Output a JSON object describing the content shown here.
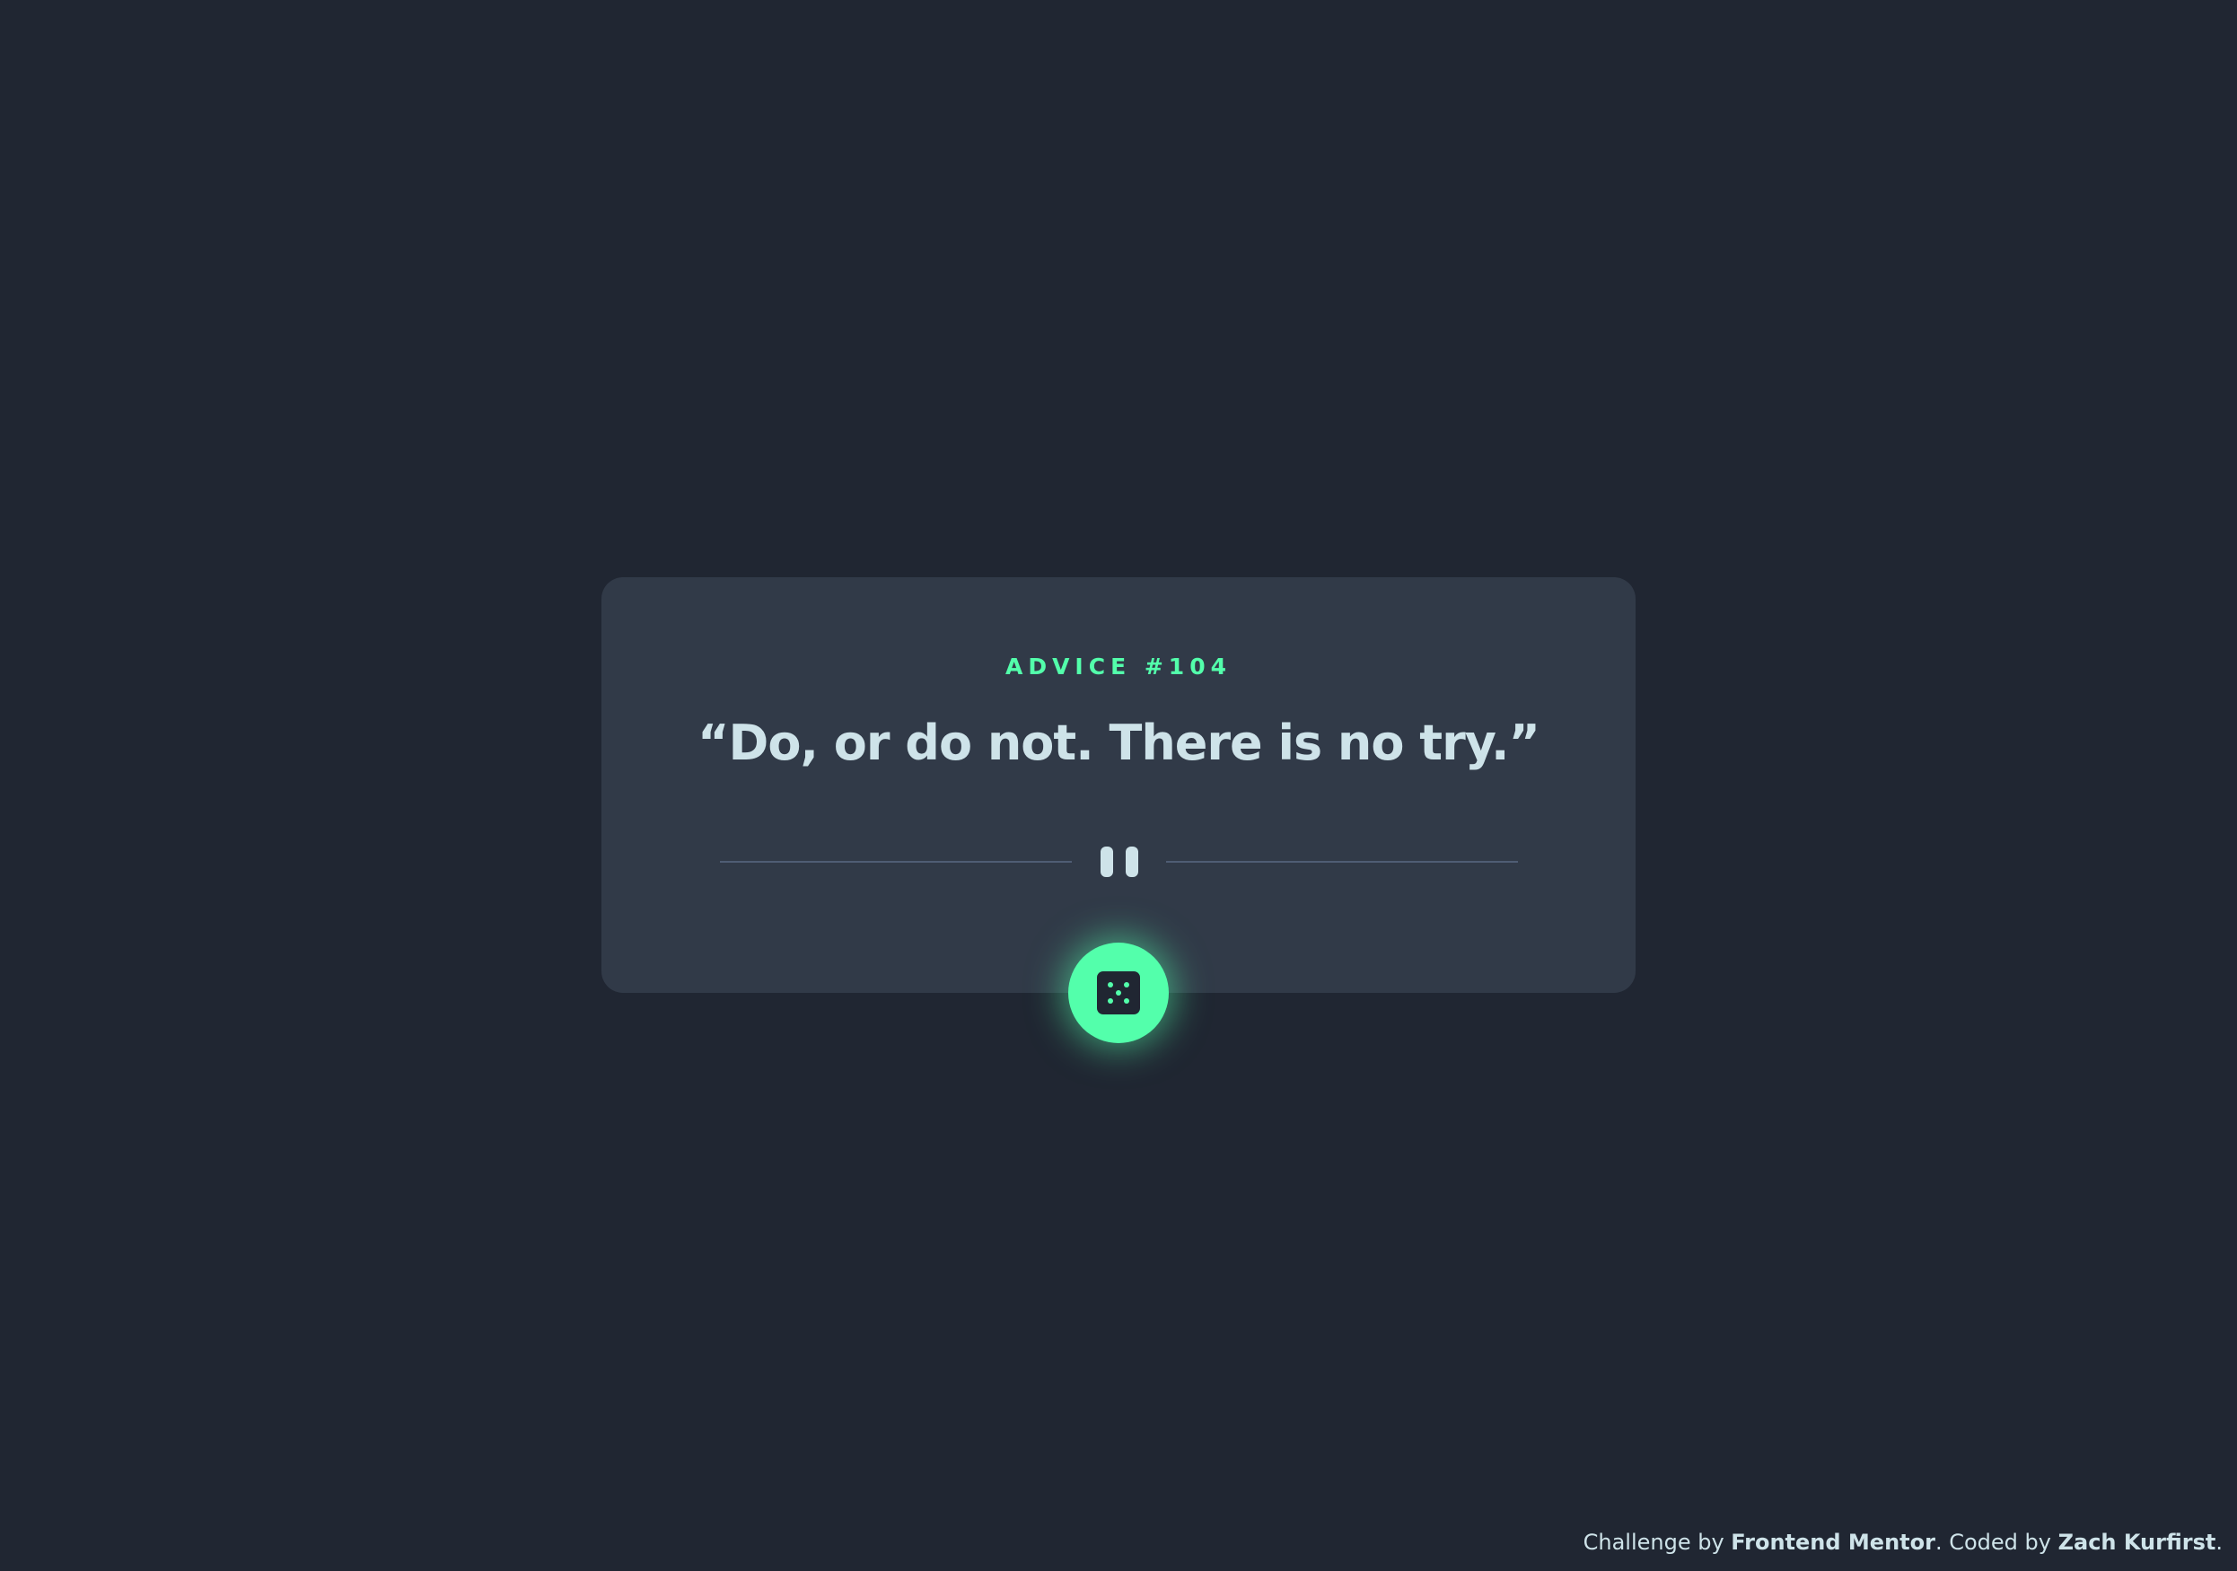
{
  "advice": {
    "id_label": "ADVICE #104",
    "quote": "“Do, or do not. There is no try.”"
  },
  "divider": {
    "icon": "pause-icon"
  },
  "dice_button": {
    "icon": "dice-icon"
  },
  "footer": {
    "prefix": "Challenge by ",
    "challenge_link": "Frontend Mentor",
    "middle": ". Coded by ",
    "author_link": "Zach Kurfirst",
    "suffix": "."
  },
  "colors": {
    "background": "#202632",
    "card": "#313a48",
    "accent": "#53ffab",
    "text": "#cee3e9",
    "divider": "#4f5d74"
  }
}
